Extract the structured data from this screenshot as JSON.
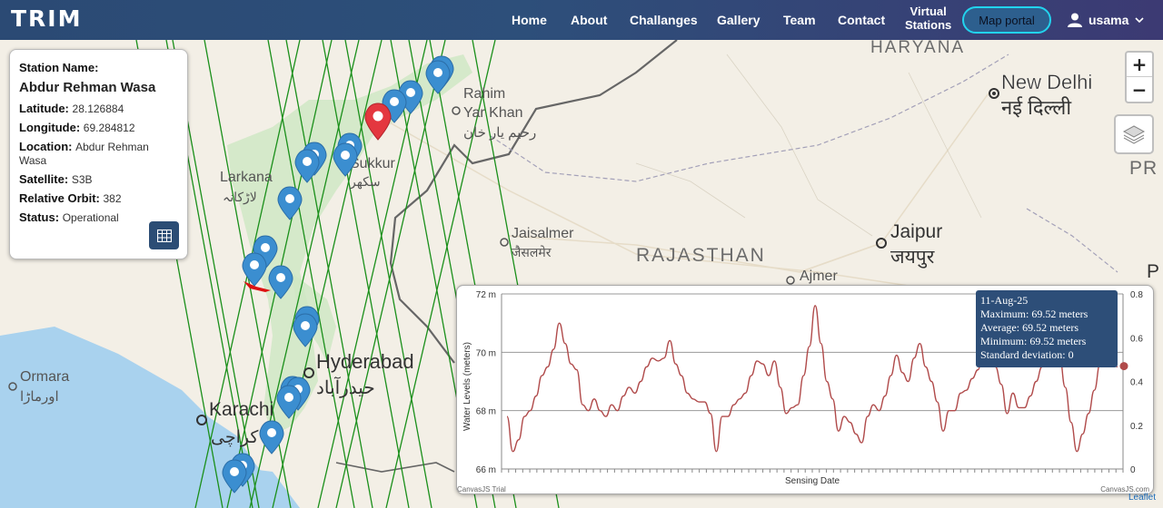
{
  "brand": "TRIM",
  "nav": {
    "home": "Home",
    "about": "About",
    "challanges": "Challanges",
    "gallery": "Gallery",
    "team": "Team",
    "contact": "Contact",
    "virtual_line1": "Virtual",
    "virtual_line2": "Stations",
    "map_portal": "Map portal",
    "user": "usama"
  },
  "map_labels": {
    "haryana": "HARYANA",
    "new_delhi": "New Delhi",
    "new_delhi_hi": "नई दिल्ली",
    "rahim1": "Rahim",
    "rahim2": "Yar Khan",
    "rahim_ur": "رحیم یار خان",
    "sukkur": "Sukkur",
    "sukkur_ur": "سکھر",
    "larkana": "Larkana",
    "larkana_ur": "لاڑکانہ",
    "jaisalmer": "Jaisalmer",
    "jaisalmer_hi": "जैसलमेर",
    "rajasthan": "RAJASTHAN",
    "jaipur": "Jaipur",
    "jaipur_hi": "जयपुर",
    "ajmer": "Ajmer",
    "hyderabad": "Hyderabad",
    "hyderabad_ur": "حیدرآباد",
    "karachi": "Karachi",
    "karachi_ur": "کراچی",
    "ormara": "Ormara",
    "ormara_ur": "اورماڑا",
    "p": "P",
    "pr": "PR"
  },
  "info": {
    "station_name_label": "Station Name:",
    "station_name": "Abdur Rehman Wasa",
    "latitude_label": "Latitude:",
    "latitude": "28.126884",
    "longitude_label": "Longitude:",
    "longitude": "69.284812",
    "location_label": "Location:",
    "location": "Abdur Rehman Wasa",
    "satellite_label": "Satellite:",
    "satellite": "S3B",
    "orbit_label": "Relative Orbit:",
    "orbit": "382",
    "status_label": "Status:",
    "status": "Operational"
  },
  "controls": {
    "zoom_in": "+",
    "zoom_out": "−",
    "attribution": "Leaflet"
  },
  "chart_data": {
    "type": "line",
    "ylabel": "Water Levels (meters)",
    "xlabel": "Sensing Date",
    "y_ticks": [
      "66 m",
      "68 m",
      "70 m",
      "72 m"
    ],
    "ylim": [
      66,
      72
    ],
    "y2_ticks": [
      "0",
      "0.2",
      "0.4",
      "0.6",
      "0.8"
    ],
    "y2lim": [
      0,
      0.8
    ],
    "grid": true,
    "series": [
      {
        "values": [
          67.8,
          66.6,
          67.0,
          67.8,
          68.0,
          68.5,
          69.2,
          69.5,
          70.1,
          71.0,
          70.3,
          69.6,
          69.4,
          68.2,
          68.0,
          68.4,
          68.0,
          67.8,
          68.2,
          68.0,
          68.5,
          68.8,
          68.6,
          69.0,
          69.5,
          69.8,
          69.7,
          69.8,
          70.4,
          69.6,
          69.2,
          68.6,
          68.4,
          68.3,
          68.3,
          67.9,
          66.6,
          67.8,
          67.8,
          68.2,
          68.4,
          68.6,
          69.2,
          69.7,
          69.6,
          69.2,
          69.7,
          68.8,
          67.9,
          68.1,
          68.2,
          69.2,
          70.2,
          71.6,
          70.3,
          69.0,
          68.4,
          67.3,
          67.8,
          67.6,
          67.2,
          66.9,
          67.8,
          68.2,
          68.0,
          68.5,
          69.2,
          69.9,
          69.3,
          69.0,
          69.8,
          70.3,
          69.5,
          69.0,
          68.3,
          67.3,
          68.0,
          68.0,
          68.6,
          68.7,
          69.1,
          69.4,
          70.4,
          69.7,
          69.5,
          68.9,
          67.9,
          68.6,
          68.1,
          68.1,
          68.5,
          69.0,
          69.5,
          70.0,
          70.6,
          69.9,
          68.8,
          67.6,
          66.6,
          67.2,
          67.9,
          68.7,
          69.6,
          69.9,
          69.6,
          69.5
        ]
      }
    ],
    "highlight_point": 0.47,
    "tooltip": {
      "date": "11-Aug-25",
      "maximum": "Maximum:  69.52 meters",
      "average": "Average:  69.52 meters",
      "minimum": "Minimum:  69.52 meters",
      "stddev": "Standard deviation:  0"
    },
    "credit_left": "CanvasJS Trial",
    "credit_right": "CanvasJS.com"
  }
}
